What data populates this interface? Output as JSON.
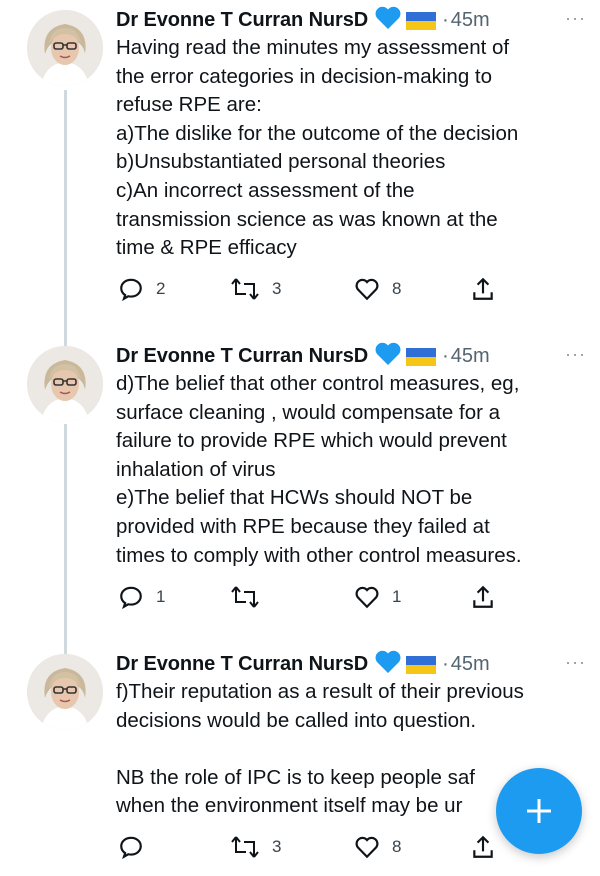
{
  "tweets": [
    {
      "author": "Dr Evonne T Curran NursD",
      "separator": "·",
      "time": "45m",
      "more": "···",
      "text": "Having read the minutes my assessment of\nthe error categories in decision-making to\nrefuse RPE are:\na)The dislike for the outcome of the decision\nb)Unsubstantiated personal theories\nc)An incorrect assessment of the\ntransmission science as was known at the\ntime & RPE efficacy",
      "replies": "2",
      "retweets": "3",
      "likes": "8"
    },
    {
      "author": "Dr Evonne T Curran NursD",
      "separator": "·",
      "time": "45m",
      "more": "···",
      "text": "d)The belief that other control measures, eg,\nsurface cleaning , would compensate for a\nfailure to provide RPE which would prevent\ninhalation of virus\ne)The belief that HCWs should NOT be\nprovided with RPE because they failed at\ntimes to comply with other control measures.",
      "replies": "1",
      "retweets": "",
      "likes": "1"
    },
    {
      "author": "Dr Evonne T Curran NursD",
      "separator": "·",
      "time": "45m",
      "more": "···",
      "text": "f)Their reputation as a result of their previous\ndecisions would be called into question.\n\nNB the role of IPC is to keep people saf\nwhen the environment itself may be ur",
      "replies": "",
      "retweets": "3",
      "likes": "8"
    }
  ],
  "colors": {
    "verified_heart": "#1d9bf0",
    "flag_blue": "#2f6fd6",
    "flag_yellow": "#f5c518",
    "fab": "#1d9bf0"
  },
  "icons": [
    "avatar",
    "blue-heart-icon",
    "ukraine-flag-icon",
    "more-icon",
    "reply-icon",
    "retweet-icon",
    "like-icon",
    "share-icon",
    "compose-plus-icon"
  ]
}
